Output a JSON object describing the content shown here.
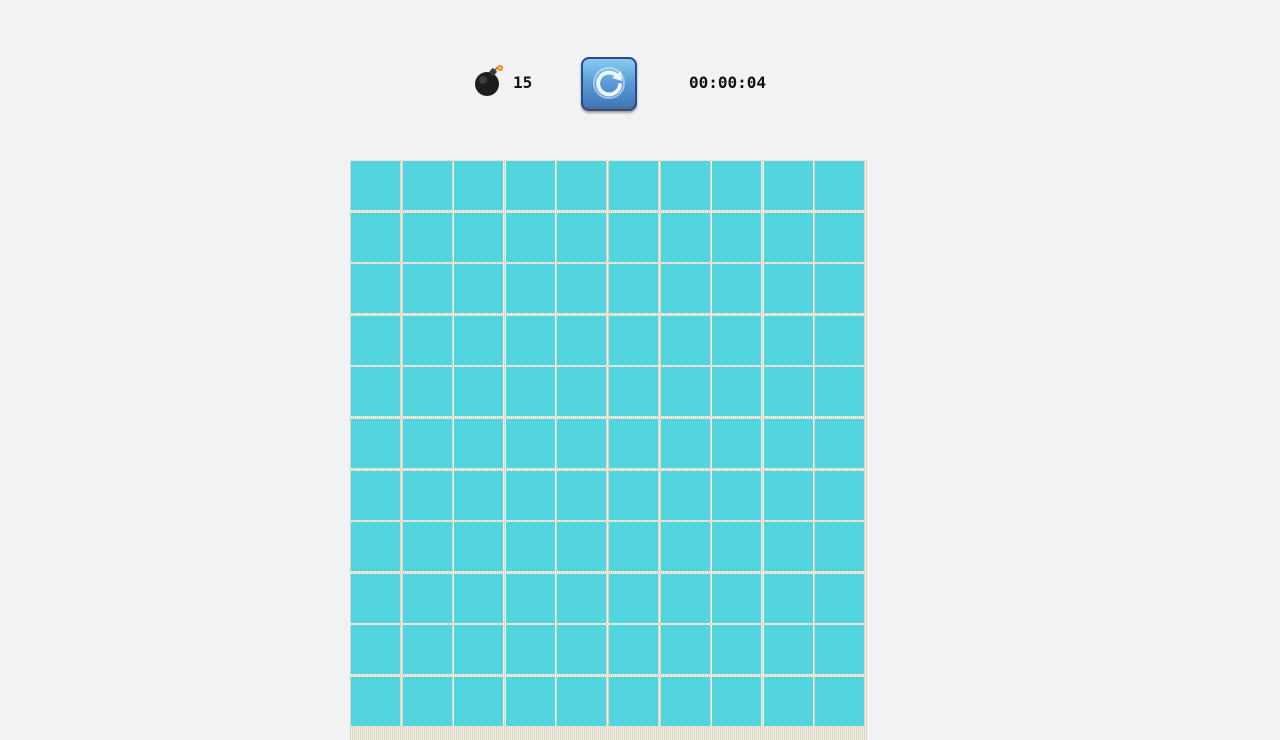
{
  "header": {
    "bomb_icon": "bomb-icon",
    "mine_count": "15",
    "reset_icon": "refresh-icon",
    "timer": "00:00:04"
  },
  "board": {
    "columns": 10,
    "visible_rows": 11,
    "cell_color": "#52d5de",
    "cell_state": "unrevealed"
  }
}
